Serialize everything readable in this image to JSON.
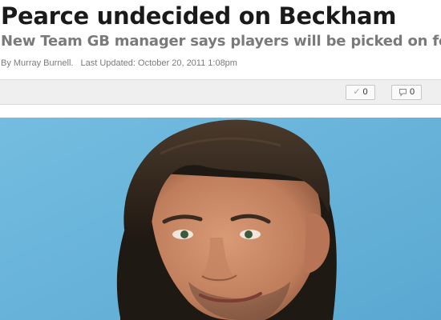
{
  "article": {
    "headline": "Pearce undecided on Beckham",
    "subheadline": "New Team GB manager says players will be picked on form",
    "byline": {
      "author": "By Murray Burnell.",
      "updated": "Last Updated: October 20, 2011 1:08pm"
    }
  },
  "social": {
    "like_count": "0",
    "like_icon": "check-icon",
    "comment_count": "0",
    "comment_icon": "speech-bubble-icon"
  },
  "photo": {
    "background_color": "#6fb6d8",
    "hair_color": "#2a2018",
    "skin_color": "#c88a68"
  }
}
